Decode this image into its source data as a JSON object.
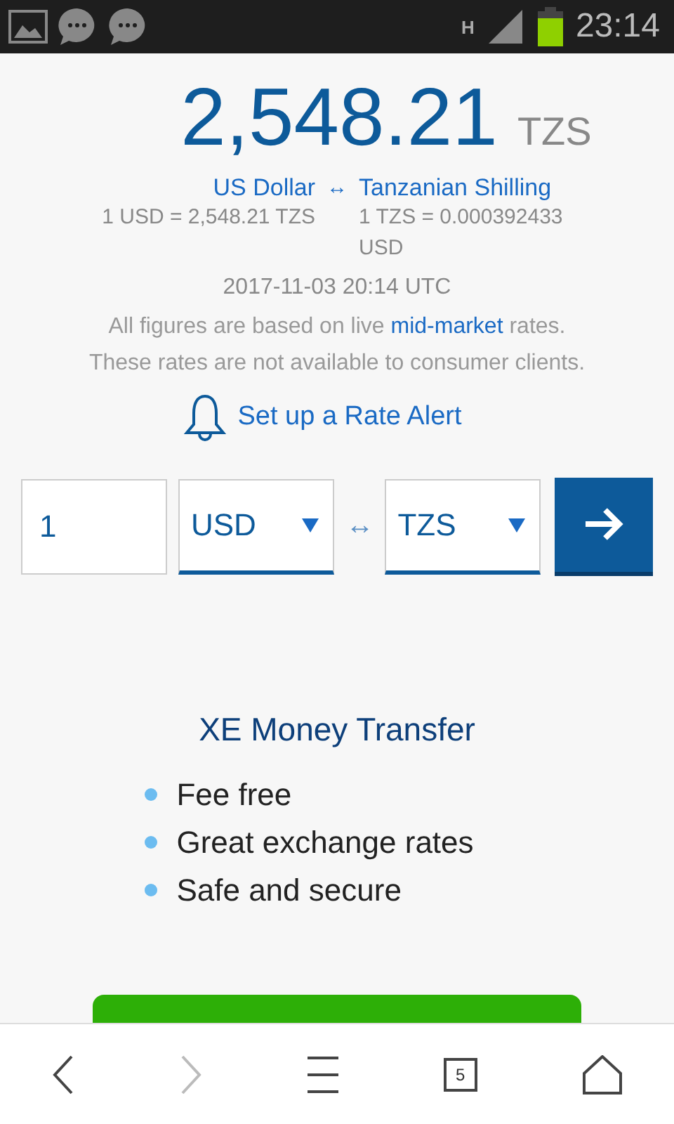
{
  "status_bar": {
    "network": "H",
    "time": "23:14"
  },
  "result": {
    "amount": "2,548.21",
    "currency": "TZS"
  },
  "currency_links": {
    "from": "US Dollar",
    "swap": "↔",
    "to": "Tanzanian Shilling"
  },
  "rates": [
    "1 USD = 2,548.21 TZS",
    "1 TZS = 0.000392433 USD"
  ],
  "timestamp": "2017-11-03 20:14 UTC",
  "disclaimer": {
    "before": "All figures are based on live ",
    "link": "mid-market",
    "after": " rates.",
    "second_line": "These rates are not available to consumer clients."
  },
  "rate_alert": "Set up a Rate Alert",
  "converter": {
    "amount": "1",
    "from": "USD",
    "swap": "↔",
    "to": "TZS"
  },
  "transfer": {
    "title": "XE Money Transfer",
    "features": [
      "Fee free",
      "Great exchange rates",
      "Safe and secure"
    ]
  },
  "browser_nav": {
    "back_disabled": false,
    "forward_disabled": true,
    "tab_count": "5"
  }
}
